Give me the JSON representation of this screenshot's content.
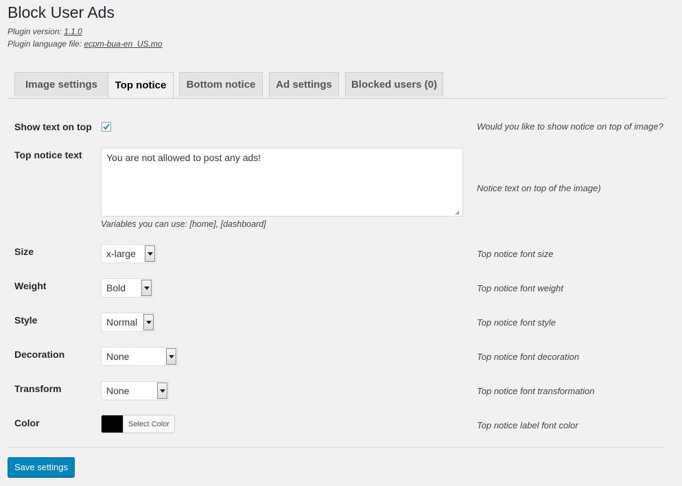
{
  "page": {
    "title": "Block User Ads",
    "version_label": "Plugin version:",
    "version_value": "1.1.0",
    "language_label": "Plugin language file:",
    "language_value": "ecpm-bua-en_US.mo"
  },
  "tabs": [
    {
      "label": "Image settings"
    },
    {
      "label": "Top notice",
      "active": true
    },
    {
      "label": "Bottom notice"
    },
    {
      "label": "Ad settings"
    },
    {
      "label": "Blocked users (0)"
    }
  ],
  "fields": {
    "show_text": {
      "label": "Show text on top",
      "checked": true,
      "desc": "Would you like to show notice on top of image?"
    },
    "notice_text": {
      "label": "Top notice text",
      "value": "You are not allowed to post any ads!",
      "hint": "Variables you can use: [home], [dashboard]",
      "desc": "Notice text on top of the image)"
    },
    "size": {
      "label": "Size",
      "value": "x-large",
      "desc": "Top notice font size"
    },
    "weight": {
      "label": "Weight",
      "value": "Bold",
      "desc": "Top notice font weight"
    },
    "style": {
      "label": "Style",
      "value": "Normal",
      "desc": "Top notice font style"
    },
    "decoration": {
      "label": "Decoration",
      "value": "None",
      "desc": "Top notice font decoration"
    },
    "transform": {
      "label": "Transform",
      "value": "None",
      "desc": "Top notice font transformation"
    },
    "color": {
      "label": "Color",
      "value": "#000000",
      "button_label": "Select Color",
      "desc": "Top notice label font color"
    }
  },
  "actions": {
    "save_label": "Save settings"
  },
  "colors": {
    "primary": "#0085ba",
    "background": "#f1f1f1"
  },
  "icons": {
    "checkbox": "checkmark-icon",
    "select": "chevron-down-icon"
  }
}
